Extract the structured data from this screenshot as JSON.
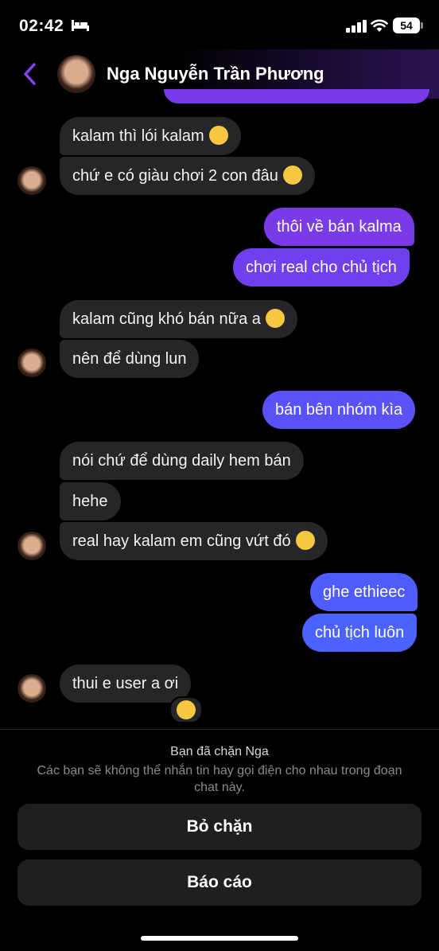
{
  "status_bar": {
    "time": "02:42",
    "battery": "54"
  },
  "header": {
    "contact_name": "Nga Nguyễn Trần Phương"
  },
  "messages": [
    {
      "text": "kalam thì lói kalam",
      "emoji": "😢"
    },
    {
      "text": "chứ e có giàu chơi 2 con đâu",
      "emoji": "😢"
    },
    {
      "text": "thôi về bán kalma"
    },
    {
      "text": "chơi real cho chủ tịch"
    },
    {
      "text": "kalam cũng khó bán nữa a",
      "emoji": "😢"
    },
    {
      "text": "nên để dùng lun"
    },
    {
      "text": "bán bên nhóm kìa"
    },
    {
      "text": "nói chứ để dùng daily hem bán"
    },
    {
      "text": "hehe"
    },
    {
      "text": "real hay kalam em cũng vứt đó",
      "emoji": "😂"
    },
    {
      "text": "ghe ethieec"
    },
    {
      "text": "chủ tịch luôn"
    },
    {
      "text": "thui e user a ơi",
      "reaction": "😢"
    }
  ],
  "blocked": {
    "title": "Bạn đã chặn Nga",
    "description": "Các bạn sẽ không thể nhắn tin hay gọi điện cho nhau trong đoạn chat này.",
    "unblock_label": "Bỏ chặn",
    "report_label": "Báo cáo"
  },
  "colors": {
    "outgoing_top": "#7b3ae8",
    "outgoing_bottom": "#4b62ff",
    "incoming": "#262628",
    "accent": "#8b3ff0"
  }
}
